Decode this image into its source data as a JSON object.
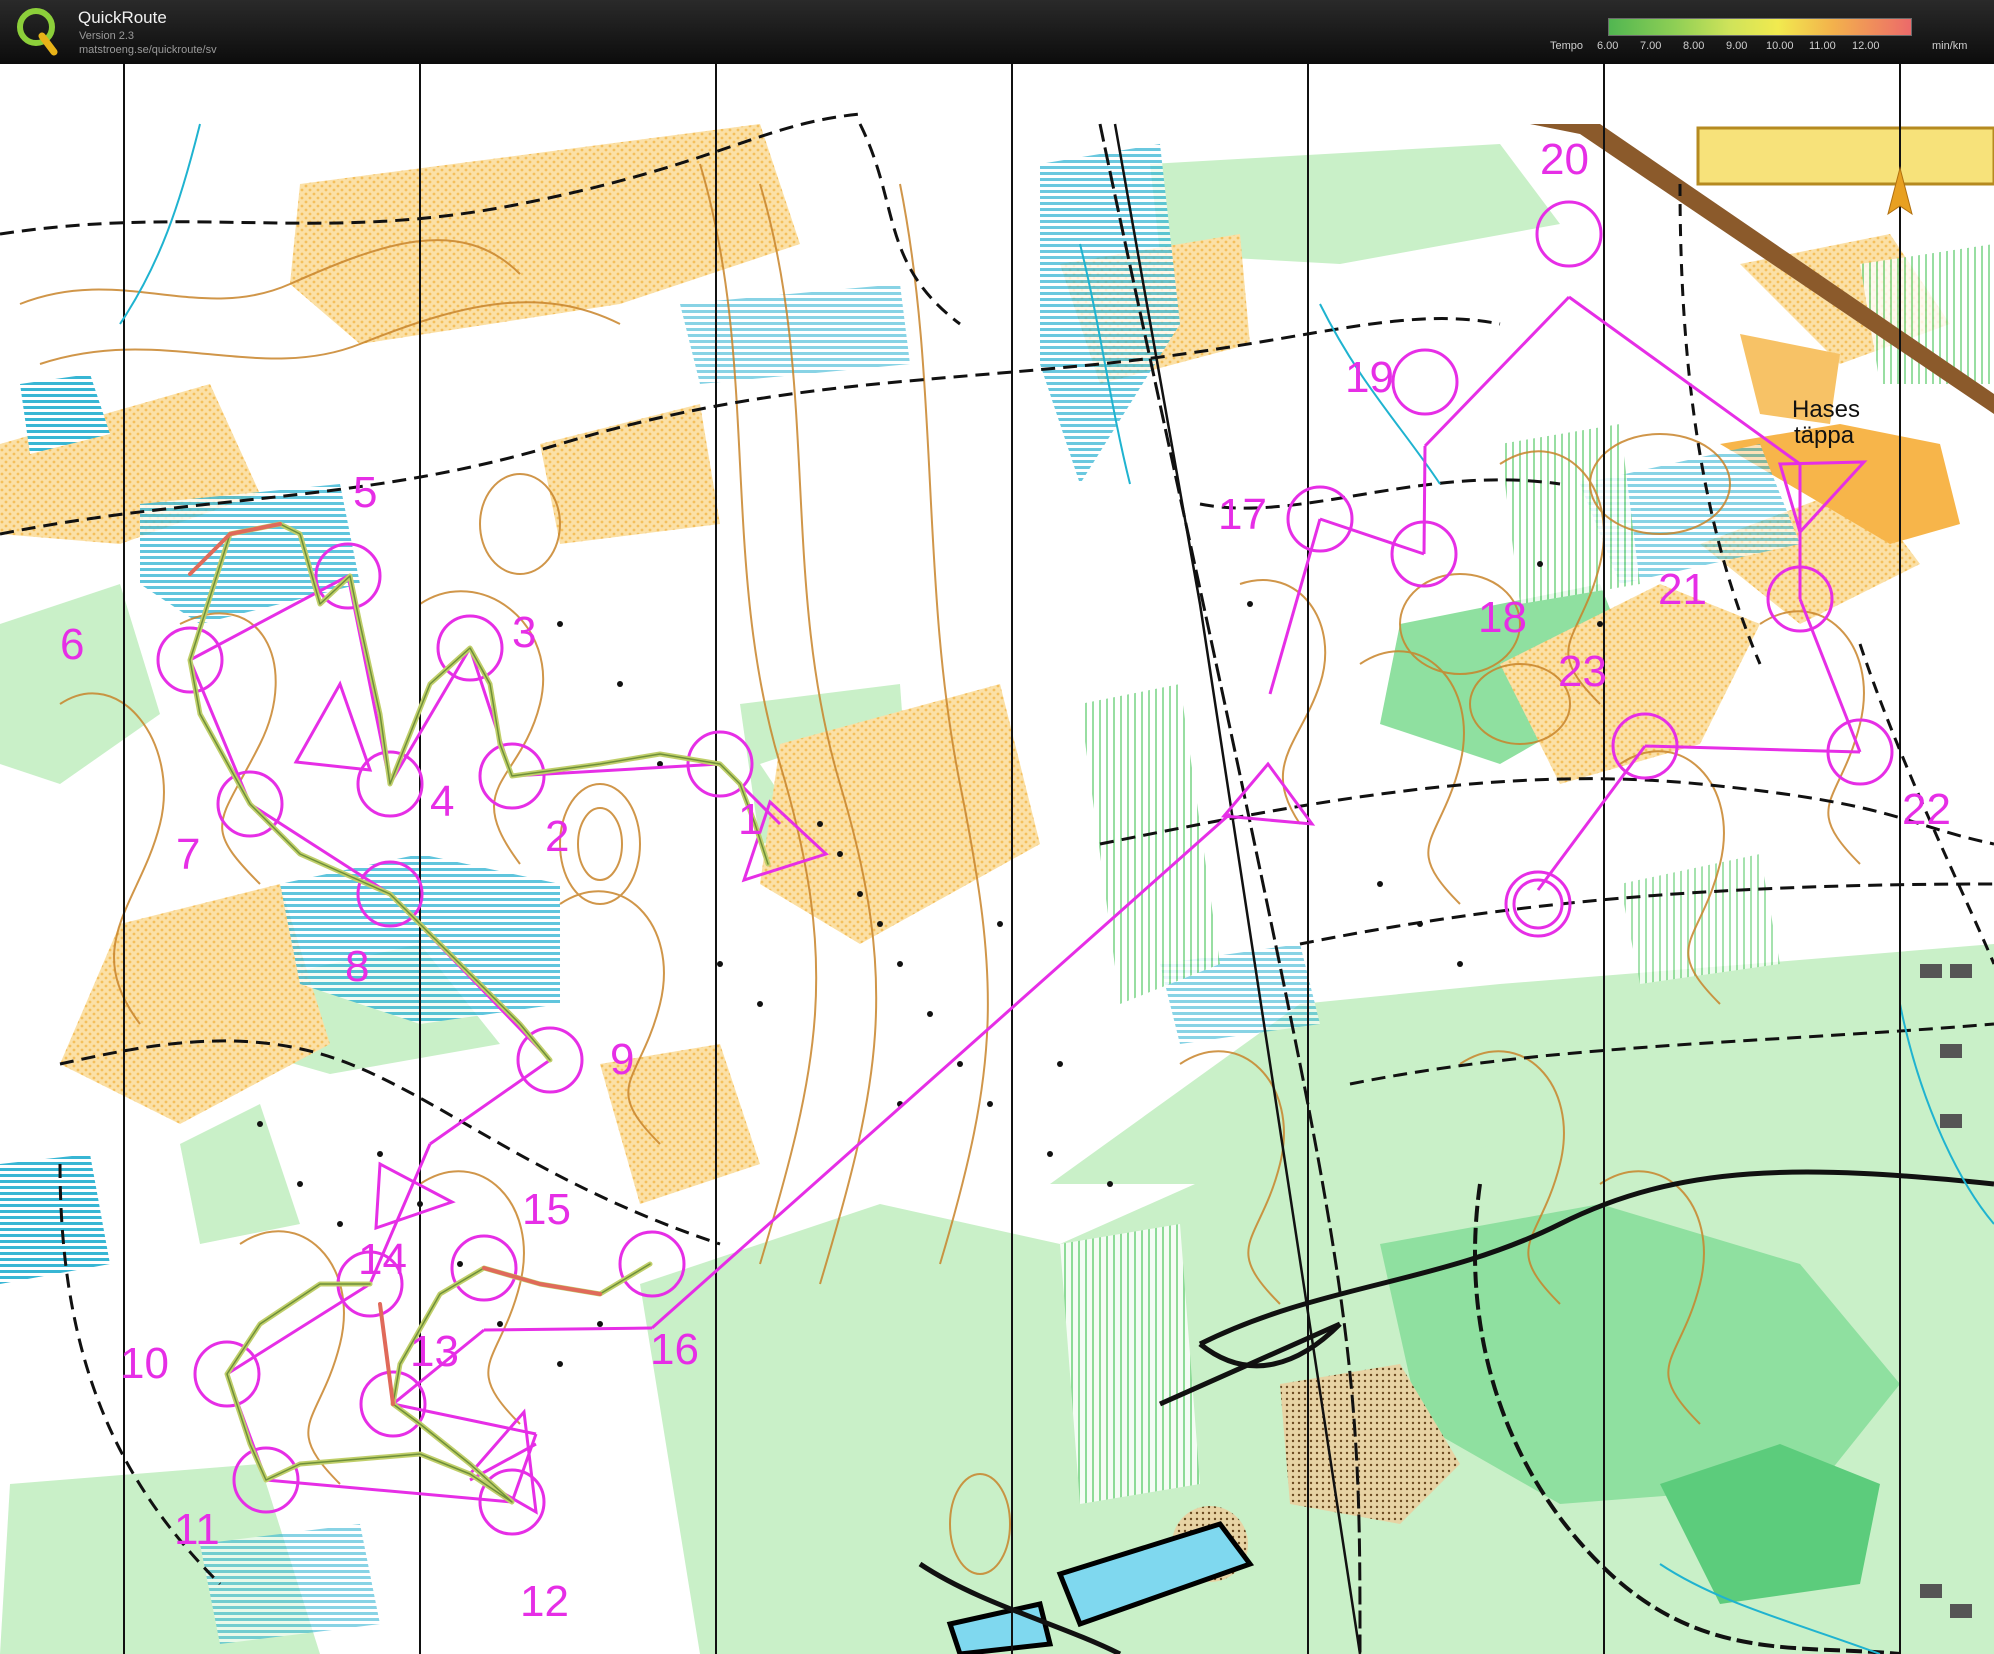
{
  "app": {
    "title": "QuickRoute",
    "version": "Version 2.3",
    "url": "matstroeng.se/quickroute/sv"
  },
  "tempo_legend": {
    "label": "Tempo",
    "ticks": [
      "6.00",
      "7.00",
      "8.00",
      "9.00",
      "10.00",
      "11.00",
      "12.00"
    ],
    "unit": "min/km",
    "gradient_colors": [
      "#51b651",
      "#8fcf55",
      "#cfe35a",
      "#f1ea4f",
      "#f3b24c",
      "#ec6a6a"
    ]
  },
  "map": {
    "place_name_line1": "Hases",
    "place_name_line2": "täppa",
    "course_color": "#e62ee6",
    "north_arrow_color": "#e8a020",
    "controls": [
      {
        "number": "1"
      },
      {
        "number": "2"
      },
      {
        "number": "3"
      },
      {
        "number": "4"
      },
      {
        "number": "5"
      },
      {
        "number": "6"
      },
      {
        "number": "7"
      },
      {
        "number": "8"
      },
      {
        "number": "9"
      },
      {
        "number": "10"
      },
      {
        "number": "11"
      },
      {
        "number": "12"
      },
      {
        "number": "13"
      },
      {
        "number": "14"
      },
      {
        "number": "15"
      },
      {
        "number": "16"
      },
      {
        "number": "17"
      },
      {
        "number": "18"
      },
      {
        "number": "19"
      },
      {
        "number": "20"
      },
      {
        "number": "21"
      },
      {
        "number": "22"
      },
      {
        "number": "23"
      }
    ]
  }
}
